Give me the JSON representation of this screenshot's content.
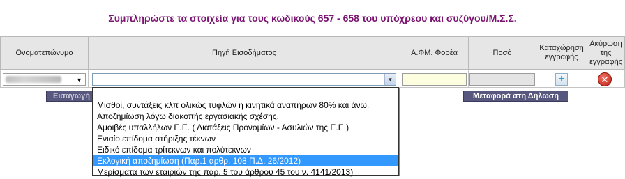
{
  "title": "Συμπληρώστε τα στοιχεία για τους κωδικούς 657 - 658 του υπόχρεου και συζύγου/Μ.Σ.Σ.",
  "table": {
    "headers": {
      "name": "Ονοματεπώνυμο",
      "source": "Πηγή Εισοδήματος",
      "afm": "Α.ΦΜ. Φορέα",
      "amount": "Ποσό",
      "register": "Καταχώρηση εγγραφής",
      "cancel": "Ακύρωση της εγγραφής"
    },
    "row": {
      "name_value": "",
      "source_value": "",
      "afm_value": "",
      "amount_value": ""
    }
  },
  "buttons": {
    "import": "Εισαγωγή",
    "transfer": "Μεταφορά στη Δήλωση"
  },
  "dropdown": {
    "options": [
      "",
      "Μισθοί, συντάξεις κλπ ολικώς τυφλών ή κινητικά αναπήρων 80% και άνω.",
      "Αποζημίωση λόγω διακοπής εργασιακής σχέσης.",
      "Αμοιβές υπαλλήλων Ε.Ε. ( Διατάξεις Προνομίων - Ασυλιών της Ε.Ε.)",
      "Ενιαίο επίδομα στήριξης τέκνων",
      "Ειδικό επίδομα τρίτεκνων και πολύτεκνων",
      "Εκλογική αποζημίωση (Παρ.1 αρθρ. 108 Π.Δ. 26/2012)",
      "Μερίσματα των εταιριών της παρ. 5 του άρθρου 45 του ν. 4141/2013)"
    ],
    "selected_index": 6
  },
  "icons": {
    "add": "plus-icon",
    "cancel": "close-icon",
    "caret": "caret-down-icon"
  },
  "colors": {
    "title": "#7a1470",
    "header_bg": "#e6e6e6",
    "button_bg": "#58587e",
    "selection": "#3399ff",
    "afm_field_bg": "#fdfde0"
  }
}
